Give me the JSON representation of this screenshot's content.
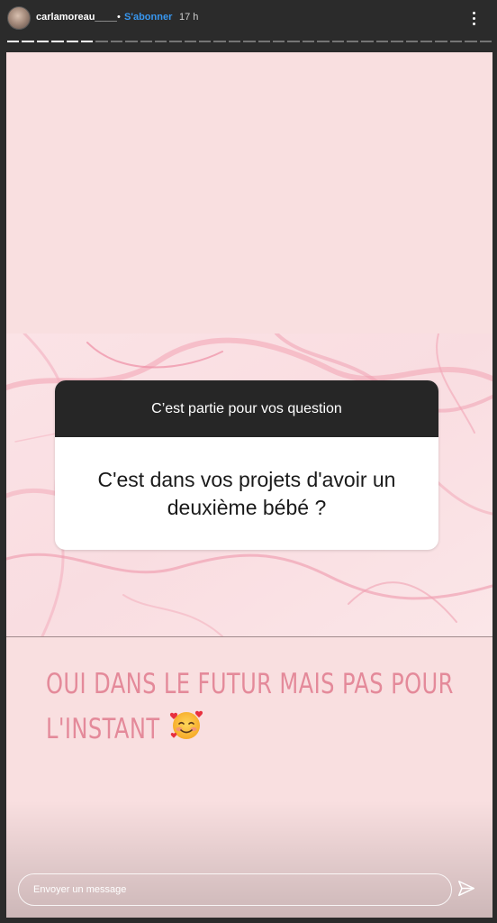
{
  "header": {
    "username": "carlamoreau____",
    "separator": "•",
    "follow_label": "S'abonner",
    "time_ago": "17 h",
    "more_icon": "more-vertical-icon"
  },
  "progress": {
    "total_segments": 33,
    "completed_segments": 6
  },
  "question_sticker": {
    "prompt": "C’est partie pour vos question",
    "question": "C'est dans vos projets d'avoir un deuxième bébé ?"
  },
  "answer": {
    "line1": "OUI DANS LE FUTUR MAIS PAS POUR",
    "line2": "L'INSTANT",
    "emoji_icon": "smiling-face-with-hearts-icon"
  },
  "reply": {
    "placeholder": "Envoyer un message",
    "send_icon": "paper-plane-icon"
  },
  "colors": {
    "story_background": "#f9dfe0",
    "answer_text": "#e48a9a",
    "follow_link": "#3897f0",
    "sticker_header": "#262626"
  }
}
